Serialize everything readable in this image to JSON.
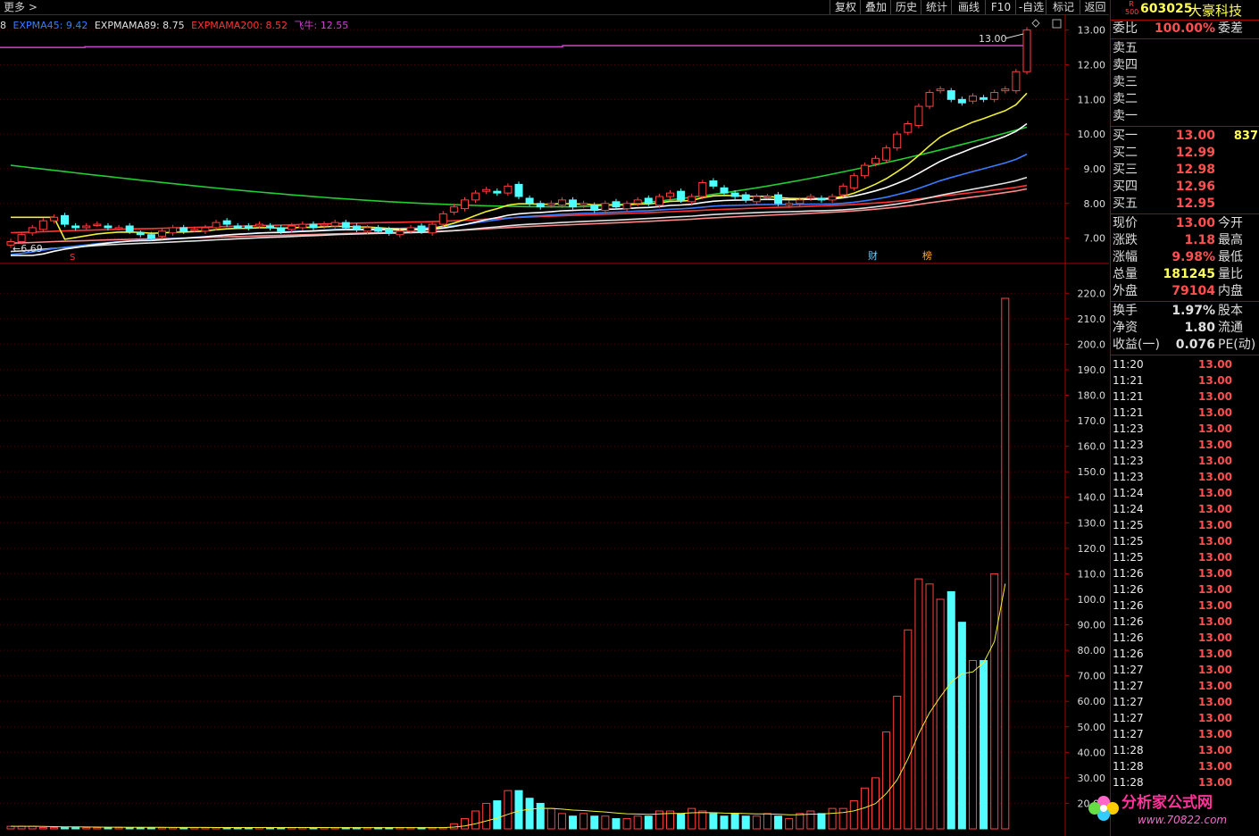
{
  "topbar": {
    "more": "更多",
    "buttons": [
      "复权",
      "叠加",
      "历史",
      "统计",
      "画线",
      "F10",
      "-自选",
      "标记",
      "返回"
    ]
  },
  "indicator": {
    "prefix": "8",
    "items": [
      {
        "label": "EXPMA45: 9.42",
        "color": "#3a7bff"
      },
      {
        "label": "EXPMAMA89: 8.75",
        "color": "#e0e0e0"
      },
      {
        "label": "EXPMAMA200: 8.52",
        "color": "#ff3333"
      },
      {
        "label": "飞牛: 12.55",
        "color": "#cc44cc"
      }
    ]
  },
  "stock": {
    "code": "603025",
    "name": "大豪科技",
    "badge_top": "R",
    "badge_bottom": "500"
  },
  "panel": {
    "webi": {
      "label": "委比",
      "value": "100.00%",
      "right": "委差"
    },
    "sells": [
      "卖五",
      "卖四",
      "卖三",
      "卖二",
      "卖一"
    ],
    "buys": [
      {
        "label": "买一",
        "price": "13.00",
        "vol": "837"
      },
      {
        "label": "买二",
        "price": "12.99",
        "vol": ""
      },
      {
        "label": "买三",
        "price": "12.98",
        "vol": ""
      },
      {
        "label": "买四",
        "price": "12.96",
        "vol": ""
      },
      {
        "label": "买五",
        "price": "12.95",
        "vol": ""
      }
    ],
    "stats": [
      {
        "label": "现价",
        "value": "13.00",
        "right": "今开",
        "color": "#ff5050"
      },
      {
        "label": "涨跌",
        "value": "1.18",
        "right": "最高",
        "color": "#ff5050"
      },
      {
        "label": "涨幅",
        "value": "9.98%",
        "right": "最低",
        "color": "#ff5050"
      },
      {
        "label": "总量",
        "value": "181245",
        "right": "量比",
        "color": "#ffff55"
      },
      {
        "label": "外盘",
        "value": "79104",
        "right": "内盘",
        "color": "#ff5050"
      }
    ],
    "stats2": [
      {
        "label": "换手",
        "value": "1.97%",
        "right": "股本",
        "color": "#e0e0e0"
      },
      {
        "label": "净资",
        "value": "1.80",
        "right": "流通",
        "color": "#e0e0e0"
      },
      {
        "label": "收益(一)",
        "value": "0.076",
        "right": "PE(动)",
        "color": "#e0e0e0"
      }
    ],
    "ticks": [
      {
        "t": "11:20",
        "p": "13.00"
      },
      {
        "t": "11:21",
        "p": "13.00"
      },
      {
        "t": "11:21",
        "p": "13.00"
      },
      {
        "t": "11:21",
        "p": "13.00"
      },
      {
        "t": "11:23",
        "p": "13.00"
      },
      {
        "t": "11:23",
        "p": "13.00"
      },
      {
        "t": "11:23",
        "p": "13.00"
      },
      {
        "t": "11:23",
        "p": "13.00"
      },
      {
        "t": "11:24",
        "p": "13.00"
      },
      {
        "t": "11:24",
        "p": "13.00"
      },
      {
        "t": "11:25",
        "p": "13.00"
      },
      {
        "t": "11:25",
        "p": "13.00"
      },
      {
        "t": "11:25",
        "p": "13.00"
      },
      {
        "t": "11:26",
        "p": "13.00"
      },
      {
        "t": "11:26",
        "p": "13.00"
      },
      {
        "t": "11:26",
        "p": "13.00"
      },
      {
        "t": "11:26",
        "p": "13.00"
      },
      {
        "t": "11:26",
        "p": "13.00"
      },
      {
        "t": "11:26",
        "p": "13.00"
      },
      {
        "t": "11:27",
        "p": "13.00"
      },
      {
        "t": "11:27",
        "p": "13.00"
      },
      {
        "t": "11:27",
        "p": "13.00"
      },
      {
        "t": "11:27",
        "p": "13.00"
      },
      {
        "t": "11:27",
        "p": "13.00"
      },
      {
        "t": "11:28",
        "p": "13.00"
      },
      {
        "t": "11:28",
        "p": "13.00"
      },
      {
        "t": "11:28",
        "p": "13.00"
      }
    ]
  },
  "chart_data": [
    {
      "type": "candlestick",
      "yticks": [
        "13.00",
        "12.00",
        "11.00",
        "10.00",
        "9.00",
        "8.00",
        "7.00"
      ],
      "ylim": [
        6.5,
        13.3
      ],
      "annotations": [
        "13.00",
        "6.69",
        "财",
        "榜",
        "S"
      ],
      "closes": [
        6.9,
        7.1,
        7.3,
        7.5,
        7.6,
        7.4,
        7.3,
        7.35,
        7.4,
        7.3,
        7.3,
        7.2,
        7.1,
        7.0,
        7.2,
        7.3,
        7.2,
        7.25,
        7.3,
        7.45,
        7.4,
        7.35,
        7.3,
        7.4,
        7.3,
        7.2,
        7.35,
        7.4,
        7.3,
        7.4,
        7.45,
        7.3,
        7.25,
        7.3,
        7.2,
        7.15,
        7.2,
        7.3,
        7.2,
        7.4,
        7.7,
        7.9,
        8.1,
        8.3,
        8.4,
        8.3,
        8.5,
        8.2,
        8.0,
        7.9,
        8.0,
        8.1,
        7.9,
        8.0,
        7.8,
        8.0,
        7.9,
        8.0,
        8.1,
        8.0,
        8.2,
        8.3,
        8.1,
        8.2,
        8.6,
        8.5,
        8.3,
        8.2,
        8.1,
        8.2,
        8.2,
        8.0,
        8.0,
        8.1,
        8.2,
        8.1,
        8.2,
        8.5,
        8.8,
        9.1,
        9.3,
        9.6,
        10.0,
        10.3,
        10.8,
        11.2,
        11.3,
        11.0,
        10.9,
        11.1,
        11.0,
        11.2,
        11.3,
        11.8,
        13.0
      ],
      "series": [
        {
          "name": "EXPMA45",
          "color": "#3a7bff",
          "last": 9.42
        },
        {
          "name": "EXPMAMA89",
          "color": "#e0e0e0",
          "last": 8.75
        },
        {
          "name": "EXPMAMA200",
          "color": "#ff3333",
          "last": 8.52
        },
        {
          "name": "飞牛",
          "color": "#cc44cc",
          "last": 12.55
        }
      ]
    },
    {
      "type": "bar",
      "yticks": [
        "220.0",
        "210.0",
        "200.0",
        "190.0",
        "180.0",
        "170.0",
        "160.0",
        "150.0",
        "140.0",
        "130.0",
        "120.0",
        "110.0",
        "100.0",
        "90.00",
        "80.00",
        "70.00",
        "60.00",
        "50.00",
        "40.00",
        "30.00",
        "20.00"
      ],
      "ylim": [
        10,
        225
      ],
      "values": [
        11,
        11,
        11,
        10.5,
        10.5,
        10.5,
        10.5,
        10.5,
        10.5,
        10.5,
        10.5,
        10.5,
        10.5,
        10.5,
        10.5,
        10.5,
        10.5,
        10.5,
        10.5,
        10.5,
        10.5,
        10.5,
        10.5,
        10.5,
        10.5,
        10.5,
        10.5,
        10.5,
        10.5,
        10.5,
        10.5,
        10.5,
        10.5,
        10.5,
        10.5,
        10.5,
        10.5,
        10.5,
        10.5,
        10.5,
        10.5,
        12,
        14,
        17,
        20,
        21,
        25,
        25,
        22,
        20,
        18,
        16,
        15,
        16,
        15,
        15,
        14,
        14,
        15,
        15,
        17,
        17,
        16,
        18,
        17,
        16,
        15,
        16,
        15,
        15,
        16,
        15,
        14,
        16,
        17,
        16,
        18,
        18,
        21,
        26,
        30,
        48,
        62,
        88,
        108,
        106,
        100,
        103,
        91,
        76,
        76,
        110,
        218
      ],
      "colors": "up red / down cyan"
    }
  ]
}
